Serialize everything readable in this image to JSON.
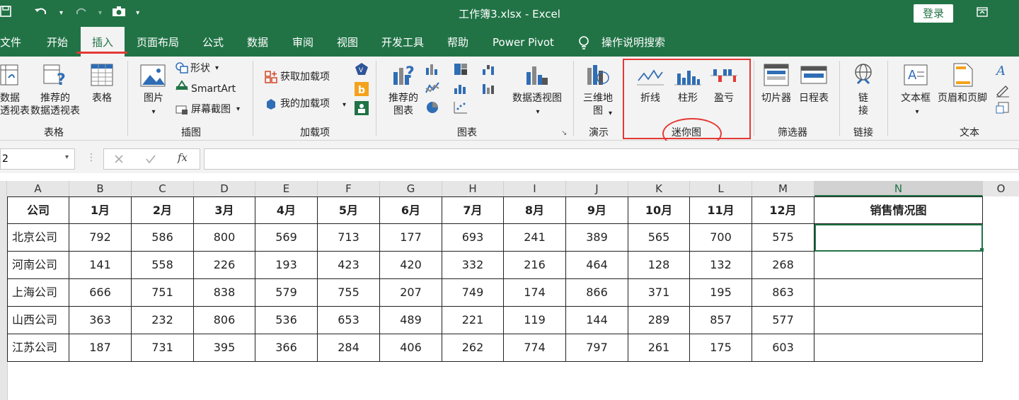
{
  "title": "工作簿3.xlsx - Excel",
  "login": "登录",
  "menu": [
    "文件",
    "开始",
    "插入",
    "页面布局",
    "公式",
    "数据",
    "审阅",
    "视图",
    "开发工具",
    "帮助",
    "Power Pivot",
    "操作说明搜索"
  ],
  "ribbon": {
    "table": {
      "pivot": "数据\n透视表",
      "recommended_pivot": "推荐的\n数据透视表",
      "table": "表格",
      "group": "表格"
    },
    "illus": {
      "pictures": "图片",
      "shapes": "形状",
      "smartart": "SmartArt",
      "screenshot": "屏幕截图",
      "group": "插图"
    },
    "addins": {
      "get": "获取加载项",
      "mine": "我的加载项",
      "group": "加载项"
    },
    "charts": {
      "recommended": "推荐的\n图表",
      "pivotchart": "数据透视图",
      "group": "图表"
    },
    "tours": {
      "map3d": "三维地\n图",
      "group": "演示"
    },
    "spark": {
      "line": "折线",
      "column": "柱形",
      "winloss": "盈亏",
      "group": "迷你图"
    },
    "filters": {
      "slicer": "切片器",
      "timeline": "日程表",
      "group": "筛选器"
    },
    "links": {
      "link": "链\n接",
      "group": "链接"
    },
    "text": {
      "textbox": "文本框",
      "headerfooter": "页眉和页脚",
      "group": "文本"
    }
  },
  "namebox": "2",
  "fx": "fx",
  "columns": [
    "A",
    "B",
    "C",
    "D",
    "E",
    "F",
    "G",
    "H",
    "I",
    "J",
    "K",
    "L",
    "M",
    "N",
    "O"
  ],
  "table": {
    "headers": [
      "公司",
      "1月",
      "2月",
      "3月",
      "4月",
      "5月",
      "6月",
      "7月",
      "8月",
      "9月",
      "10月",
      "11月",
      "12月",
      "销售情况图"
    ],
    "rows": [
      [
        "北京公司",
        "792",
        "586",
        "800",
        "569",
        "713",
        "177",
        "693",
        "241",
        "389",
        "565",
        "700",
        "575",
        ""
      ],
      [
        "河南公司",
        "141",
        "558",
        "226",
        "193",
        "423",
        "420",
        "332",
        "216",
        "464",
        "128",
        "132",
        "268",
        ""
      ],
      [
        "上海公司",
        "666",
        "751",
        "838",
        "579",
        "755",
        "207",
        "749",
        "174",
        "866",
        "371",
        "195",
        "863",
        ""
      ],
      [
        "山西公司",
        "363",
        "232",
        "806",
        "536",
        "653",
        "489",
        "221",
        "119",
        "144",
        "289",
        "857",
        "577",
        ""
      ],
      [
        "江苏公司",
        "187",
        "731",
        "395",
        "366",
        "284",
        "406",
        "262",
        "774",
        "797",
        "261",
        "175",
        "603",
        ""
      ]
    ]
  },
  "colors": {
    "accent": "#217346",
    "highlight": "#e53935"
  }
}
